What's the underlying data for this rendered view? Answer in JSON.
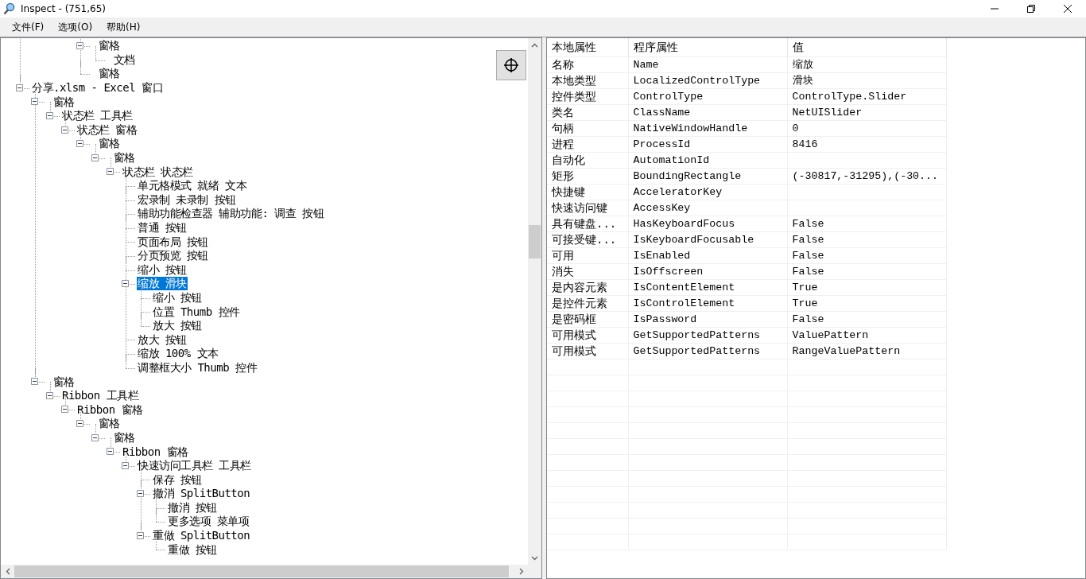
{
  "window": {
    "title": "Inspect - (751,65)"
  },
  "menu": [
    "文件(F)",
    "选项(O)",
    "帮助(H)"
  ],
  "tree": [
    {
      "children": [
        {
          "children": [
            {
              "children": [
                {
                  "children": [
                    {
                      "label": " 窗格",
                      "expanded": true,
                      "selected": false,
                      "children": [
                        {
                          "label": " 文档",
                          "selected": false
                        }
                      ]
                    },
                    {
                      "label": " 窗格",
                      "selected": false
                    }
                  ]
                }
              ]
            }
          ]
        }
      ]
    },
    {
      "label": "分享.xlsm - Excel 窗口",
      "expanded": true,
      "selected": false,
      "children": [
        {
          "label": " 窗格",
          "expanded": true,
          "selected": false,
          "children": [
            {
              "label": "状态栏 工具栏",
              "expanded": true,
              "selected": false,
              "children": [
                {
                  "label": "状态栏 窗格",
                  "expanded": true,
                  "selected": false,
                  "children": [
                    {
                      "label": " 窗格",
                      "expanded": true,
                      "selected": false,
                      "children": [
                        {
                          "label": " 窗格",
                          "expanded": true,
                          "selected": false,
                          "children": [
                            {
                              "label": "状态栏 状态栏",
                              "expanded": true,
                              "selected": false,
                              "children": [
                                {
                                  "label": "单元格模式 就绪 文本",
                                  "selected": false
                                },
                                {
                                  "label": "宏录制 未录制 按钮",
                                  "selected": false
                                },
                                {
                                  "label": "辅助功能检查器 辅助功能: 调查 按钮",
                                  "selected": false
                                },
                                {
                                  "label": "普通 按钮",
                                  "selected": false
                                },
                                {
                                  "label": "页面布局 按钮",
                                  "selected": false
                                },
                                {
                                  "label": "分页预览 按钮",
                                  "selected": false
                                },
                                {
                                  "label": "缩小 按钮",
                                  "selected": false
                                },
                                {
                                  "label": "缩放 滑块",
                                  "expanded": true,
                                  "selected": true,
                                  "children": [
                                    {
                                      "label": "缩小 按钮",
                                      "selected": false
                                    },
                                    {
                                      "label": "位置 Thumb 控件",
                                      "selected": false
                                    },
                                    {
                                      "label": "放大 按钮",
                                      "selected": false
                                    }
                                  ]
                                },
                                {
                                  "label": "放大 按钮",
                                  "selected": false
                                },
                                {
                                  "label": "缩放 100% 文本",
                                  "selected": false
                                },
                                {
                                  "label": "调整框大小 Thumb 控件",
                                  "selected": false
                                }
                              ]
                            }
                          ]
                        }
                      ]
                    }
                  ]
                }
              ]
            }
          ]
        },
        {
          "label": " 窗格",
          "expanded": true,
          "selected": false,
          "children": [
            {
              "label": "Ribbon 工具栏",
              "expanded": true,
              "selected": false,
              "children": [
                {
                  "label": "Ribbon 窗格",
                  "expanded": true,
                  "selected": false,
                  "children": [
                    {
                      "label": " 窗格",
                      "expanded": true,
                      "selected": false,
                      "children": [
                        {
                          "label": " 窗格",
                          "expanded": true,
                          "selected": false,
                          "children": [
                            {
                              "label": "Ribbon 窗格",
                              "expanded": true,
                              "selected": false,
                              "children": [
                                {
                                  "label": "快速访问工具栏 工具栏",
                                  "expanded": true,
                                  "selected": false,
                                  "children": [
                                    {
                                      "label": "保存 按钮",
                                      "selected": false
                                    },
                                    {
                                      "label": "撤消 SplitButton",
                                      "expanded": true,
                                      "selected": false,
                                      "children": [
                                        {
                                          "label": "撤消 按钮",
                                          "selected": false
                                        },
                                        {
                                          "label": "更多选项 菜单项",
                                          "selected": false
                                        }
                                      ]
                                    },
                                    {
                                      "label": "重做 SplitButton",
                                      "expanded": true,
                                      "selected": false,
                                      "children": [
                                        {
                                          "label": "重做 按钮",
                                          "selected": false
                                        }
                                      ]
                                    }
                                  ]
                                }
                              ]
                            }
                          ]
                        }
                      ]
                    }
                  ]
                }
              ]
            }
          ]
        }
      ]
    }
  ],
  "properties": {
    "columns": [
      "本地属性",
      "程序属性",
      "值"
    ],
    "rows": [
      [
        "名称",
        "Name",
        "缩放"
      ],
      [
        "本地类型",
        "LocalizedControlType",
        "滑块"
      ],
      [
        "控件类型",
        "ControlType",
        "ControlType.Slider"
      ],
      [
        "类名",
        "ClassName",
        "NetUISlider"
      ],
      [
        "句柄",
        "NativeWindowHandle",
        "0"
      ],
      [
        "进程",
        "ProcessId",
        "8416"
      ],
      [
        "自动化",
        "AutomationId",
        ""
      ],
      [
        "矩形",
        "BoundingRectangle",
        "(-30817,-31295),(-30..."
      ],
      [
        "快捷键",
        "AcceleratorKey",
        ""
      ],
      [
        "快速访问键",
        "AccessKey",
        ""
      ],
      [
        "具有键盘...",
        "HasKeyboardFocus",
        "False"
      ],
      [
        "可接受键...",
        "IsKeyboardFocusable",
        "False"
      ],
      [
        "可用",
        "IsEnabled",
        "False"
      ],
      [
        "消失",
        "IsOffscreen",
        "False"
      ],
      [
        "是内容元素",
        "IsContentElement",
        "True"
      ],
      [
        "是控件元素",
        "IsControlElement",
        "True"
      ],
      [
        "是密码框",
        "IsPassword",
        "False"
      ],
      [
        "可用模式",
        "GetSupportedPatterns",
        "ValuePattern"
      ],
      [
        "可用模式",
        "GetSupportedPatterns",
        "RangeValuePattern"
      ]
    ]
  }
}
